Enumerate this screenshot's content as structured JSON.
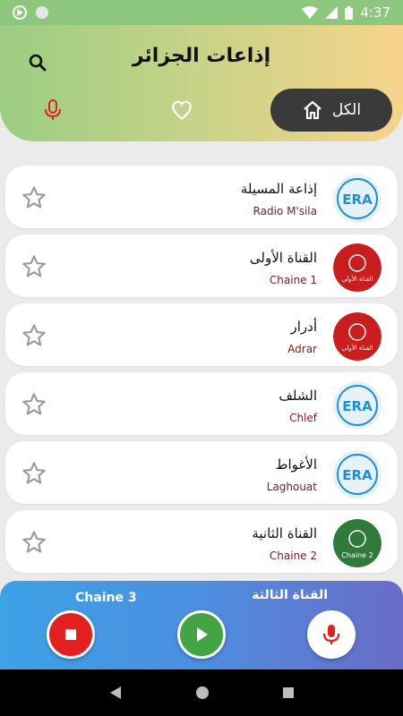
{
  "status_bar": {
    "time": "4:37"
  },
  "header": {
    "title": "إذاعات الجزائر",
    "tab_all_label": "الكل"
  },
  "stations": [
    {
      "ar": "إذاعة المسيلة",
      "en": "Radio M'sila",
      "logo": "era",
      "logo_text": "ERA"
    },
    {
      "ar": "القناة الأولى",
      "en": "Chaine 1",
      "logo": "red",
      "logo_text": "القناة الأولى"
    },
    {
      "ar": "أدرار",
      "en": "Adrar",
      "logo": "red",
      "logo_text": "القناة الأولى"
    },
    {
      "ar": "الشلف",
      "en": "Chlef",
      "logo": "era",
      "logo_text": "ERA"
    },
    {
      "ar": "الأغواط",
      "en": "Laghouat",
      "logo": "era",
      "logo_text": "ERA"
    },
    {
      "ar": "القناة الثانية",
      "en": "Chaine 2",
      "logo": "green",
      "logo_text": "Chaine 2"
    }
  ],
  "player": {
    "en_name": "Chaine 3",
    "ar_name": "القناة الثالثة"
  },
  "colors": {
    "era_blue": "#1f8fd6",
    "chaine1_red": "#c81e1e",
    "chaine2_green": "#2f7a3a",
    "accent_red": "#e31f1f",
    "play_green": "#43a444"
  }
}
